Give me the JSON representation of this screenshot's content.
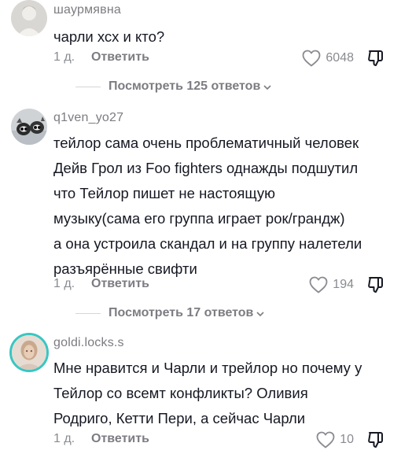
{
  "comments": [
    {
      "username": "шаурмявна",
      "lines": [
        "чарли хсх и кто?"
      ],
      "time": "1 д.",
      "reply_label": "Ответить",
      "likes": "6048",
      "view_replies": "Посмотреть 125 ответов"
    },
    {
      "username": "q1ven_yo27",
      "lines": [
        "тейлор сама очень проблематичный человек",
        "Дейв Грол из Foo fighters однажды подшутил",
        "что Тейлор пишет не настоящую",
        "музыку(сама его группа играет рок/грандж)",
        "а она устроила скандал и на группу налетели",
        "разъярённые свифти"
      ],
      "time": "1 д.",
      "reply_label": "Ответить",
      "likes": "194",
      "view_replies": "Посмотреть 17 ответов"
    },
    {
      "username": "goldi.locks.s",
      "lines": [
        "Мне нравится и Чарли и трейлор но почему у",
        "Тейлор со всемт конфликты? Оливия",
        "Родриго, Кетти Пери, а сейчас Чарли"
      ],
      "time": "1 д.",
      "reply_label": "Ответить",
      "likes": "10"
    }
  ],
  "icons": {
    "like": "heart-outline-icon",
    "dislike": "thumbs-down-outline-icon",
    "expand": "chevron-down-icon"
  },
  "colors": {
    "text": "#161823",
    "secondary": "#7c7c82",
    "story_ring": "#39c6c2"
  }
}
